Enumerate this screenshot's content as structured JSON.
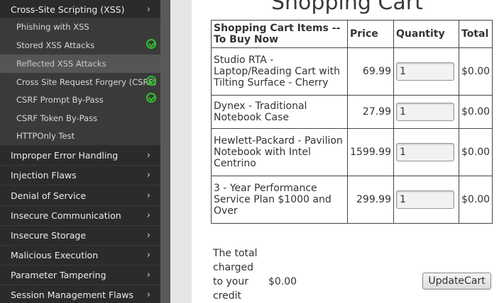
{
  "sidebar": {
    "categories_top": [
      {
        "label": "Cross-Site Scripting (XSS)"
      }
    ],
    "sub_items": [
      {
        "label": "Phishing with XSS",
        "completed": false
      },
      {
        "label": "Stored XSS Attacks",
        "completed": true
      },
      {
        "label": "Reflected XSS Attacks",
        "completed": false,
        "active": true
      },
      {
        "label": "Cross Site Request Forgery (CSRF)",
        "completed": true
      },
      {
        "label": "CSRF Prompt By-Pass",
        "completed": true
      },
      {
        "label": "CSRF Token By-Pass",
        "completed": false
      },
      {
        "label": "HTTPOnly Test",
        "completed": false
      }
    ],
    "categories": [
      {
        "label": "Improper Error Handling"
      },
      {
        "label": "Injection Flaws"
      },
      {
        "label": "Denial of Service"
      },
      {
        "label": "Insecure Communication"
      },
      {
        "label": "Insecure Storage"
      },
      {
        "label": "Malicious Execution"
      },
      {
        "label": "Parameter Tampering"
      },
      {
        "label": "Session Management Flaws"
      }
    ],
    "chevron": "›",
    "check_color": "#2fc12f"
  },
  "main": {
    "title": "Shopping Cart",
    "table": {
      "headers": [
        "Shopping Cart Items -- To Buy Now",
        "Price",
        "Quantity",
        "Total"
      ],
      "rows": [
        {
          "item": "Studio RTA - Laptop/Reading Cart with Tilting Surface - Cherry",
          "price": "69.99",
          "qty": "1",
          "total": "$0.00"
        },
        {
          "item": "Dynex - Traditional Notebook Case",
          "price": "27.99",
          "qty": "1",
          "total": "$0.00"
        },
        {
          "item": "Hewlett-Packard - Pavilion Notebook with Intel Centrino",
          "price": "1599.99",
          "qty": "1",
          "total": "$0.00"
        },
        {
          "item": "3 - Year Performance Service Plan $1000 and Over",
          "price": "299.99",
          "qty": "1",
          "total": "$0.00"
        }
      ]
    },
    "summary": {
      "label": "The total charged to your credit",
      "value": "$0.00",
      "button": "UpdateCart"
    }
  }
}
